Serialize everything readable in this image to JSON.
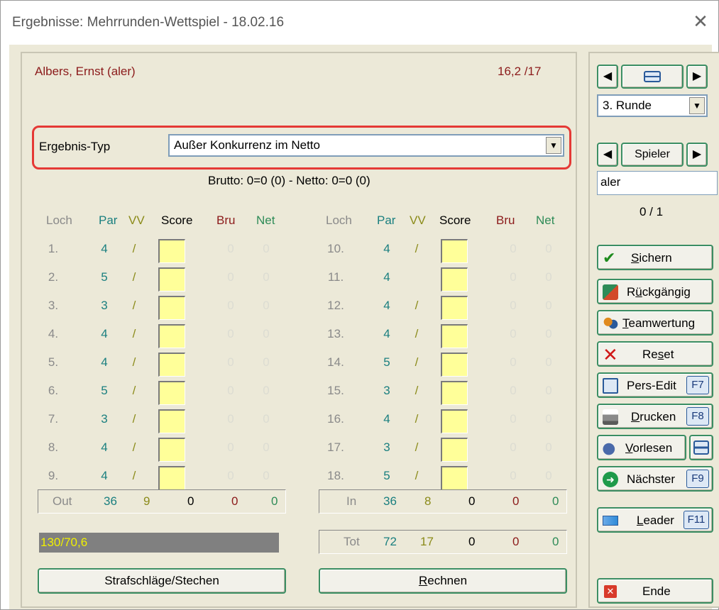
{
  "window": {
    "title": "Ergebnisse: Mehrrunden-Wettspiel - 18.02.16",
    "close_glyph": "✕"
  },
  "player": {
    "name": "Albers, Ernst (aler)",
    "handicap": "16,2 /17"
  },
  "result_type": {
    "label": "Ergebnis-Typ",
    "value": "Außer Konkurrenz im Netto"
  },
  "summary_line": "Brutto: 0=0 (0) - Netto: 0=0 (0)",
  "headers": {
    "hole": "Loch",
    "par": "Par",
    "vg": "VV",
    "score": "Score",
    "bru": "Bru",
    "net": "Net"
  },
  "front_nine": [
    {
      "hole": "1.",
      "par": "4",
      "vg": "/",
      "bru": "0",
      "net": "0"
    },
    {
      "hole": "2.",
      "par": "5",
      "vg": "/",
      "bru": "0",
      "net": "0"
    },
    {
      "hole": "3.",
      "par": "3",
      "vg": "/",
      "bru": "0",
      "net": "0"
    },
    {
      "hole": "4.",
      "par": "4",
      "vg": "/",
      "bru": "0",
      "net": "0"
    },
    {
      "hole": "5.",
      "par": "4",
      "vg": "/",
      "bru": "0",
      "net": "0"
    },
    {
      "hole": "6.",
      "par": "5",
      "vg": "/",
      "bru": "0",
      "net": "0"
    },
    {
      "hole": "7.",
      "par": "3",
      "vg": "/",
      "bru": "0",
      "net": "0"
    },
    {
      "hole": "8.",
      "par": "4",
      "vg": "/",
      "bru": "0",
      "net": "0"
    },
    {
      "hole": "9.",
      "par": "4",
      "vg": "/",
      "bru": "0",
      "net": "0"
    }
  ],
  "back_nine": [
    {
      "hole": "10.",
      "par": "4",
      "vg": "/",
      "bru": "0",
      "net": "0"
    },
    {
      "hole": "11.",
      "par": "4",
      "vg": "",
      "bru": "0",
      "net": "0"
    },
    {
      "hole": "12.",
      "par": "4",
      "vg": "/",
      "bru": "0",
      "net": "0"
    },
    {
      "hole": "13.",
      "par": "4",
      "vg": "/",
      "bru": "0",
      "net": "0"
    },
    {
      "hole": "14.",
      "par": "5",
      "vg": "/",
      "bru": "0",
      "net": "0"
    },
    {
      "hole": "15.",
      "par": "3",
      "vg": "/",
      "bru": "0",
      "net": "0"
    },
    {
      "hole": "16.",
      "par": "4",
      "vg": "/",
      "bru": "0",
      "net": "0"
    },
    {
      "hole": "17.",
      "par": "3",
      "vg": "/",
      "bru": "0",
      "net": "0"
    },
    {
      "hole": "18.",
      "par": "5",
      "vg": "/",
      "bru": "0",
      "net": "0"
    }
  ],
  "totals": {
    "out": {
      "label": "Out",
      "par": "36",
      "vg": "9",
      "score": "0",
      "bru": "0",
      "net": "0"
    },
    "in": {
      "label": "In",
      "par": "36",
      "vg": "8",
      "score": "0",
      "bru": "0",
      "net": "0"
    },
    "tot": {
      "label": "Tot",
      "par": "72",
      "vg": "17",
      "score": "0",
      "bru": "0",
      "net": "0"
    }
  },
  "course_rating": "130/70,6",
  "buttons": {
    "penalty": "Strafschläge/Stechen",
    "calculate_prefix": "",
    "calculate_underline": "R",
    "calculate_rest": "echnen"
  },
  "sidebar": {
    "round_value": "3. Runde",
    "player_nav_label": "Spieler",
    "player_search_value": "aler",
    "player_count": "0 / 1",
    "save": {
      "u": "S",
      "rest": "ichern"
    },
    "undo": {
      "pre": "R",
      "u": "ü",
      "rest": "ckgängig"
    },
    "team": {
      "u": "T",
      "rest": "eamwertung"
    },
    "reset": {
      "pre": "Re",
      "u": "s",
      "rest": "et"
    },
    "pers_edit": {
      "label": "Pers-Edit",
      "key": "F7"
    },
    "print": {
      "u": "D",
      "rest": "rucken",
      "key": "F8"
    },
    "read_aloud": {
      "u": "V",
      "rest": "orlesen"
    },
    "next": {
      "label": "Nächster",
      "key": "F9"
    },
    "leader": {
      "u": "L",
      "rest": "eader",
      "key": "F11"
    },
    "end_label": "Ende"
  },
  "colors": {
    "accent_green": "#3b8e63",
    "name_red": "#8b1a1a",
    "par_teal": "#1a7f7f",
    "vg_olive": "#8b8b1a",
    "score_yellow": "#ffff99",
    "highlight_red": "#e53935"
  }
}
